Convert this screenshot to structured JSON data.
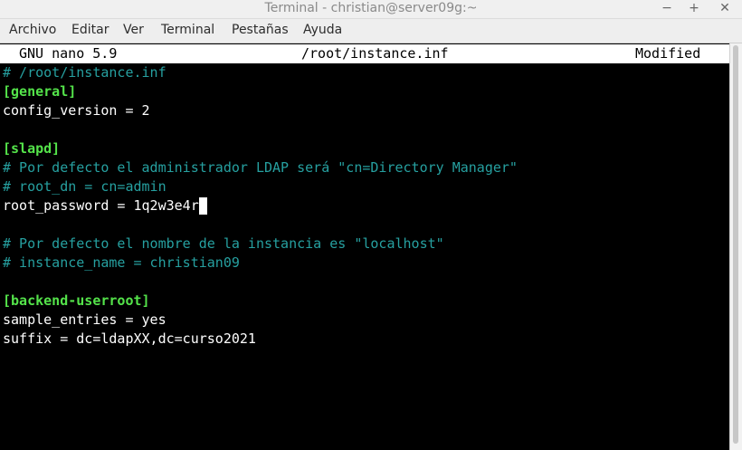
{
  "window": {
    "title": "Terminal - christian@server09g:~",
    "controls": [
      "minimize-icon",
      "maximize-icon",
      "close-icon"
    ],
    "control_glyphs": [
      "−",
      "+",
      "✕"
    ]
  },
  "menu": [
    "Archivo",
    "Editar",
    "Ver",
    "Terminal",
    "Pestañas",
    "Ayuda"
  ],
  "nano": {
    "version": "GNU nano 5.9",
    "filename": "/root/instance.inf",
    "status": "Modified"
  },
  "lines": [
    "# /root/instance.inf",
    "[general]",
    "config_version = 2",
    "",
    "[slapd]",
    "# Por defecto el administrador LDAP será \"cn=Directory Manager\"",
    "# root_dn = cn=admin",
    "root_password = 1q2w3e4r",
    "",
    "# Por defecto el nombre de la instancia es \"localhost\"",
    "# instance_name = christian09",
    "",
    "[backend-userroot]",
    "sample_entries = yes",
    "suffix = dc=ldapXX,dc=curso2021"
  ],
  "colors": {
    "comment": "#26a0a0",
    "section": "#54e34a",
    "text": "#ffffff",
    "background": "#000000"
  }
}
